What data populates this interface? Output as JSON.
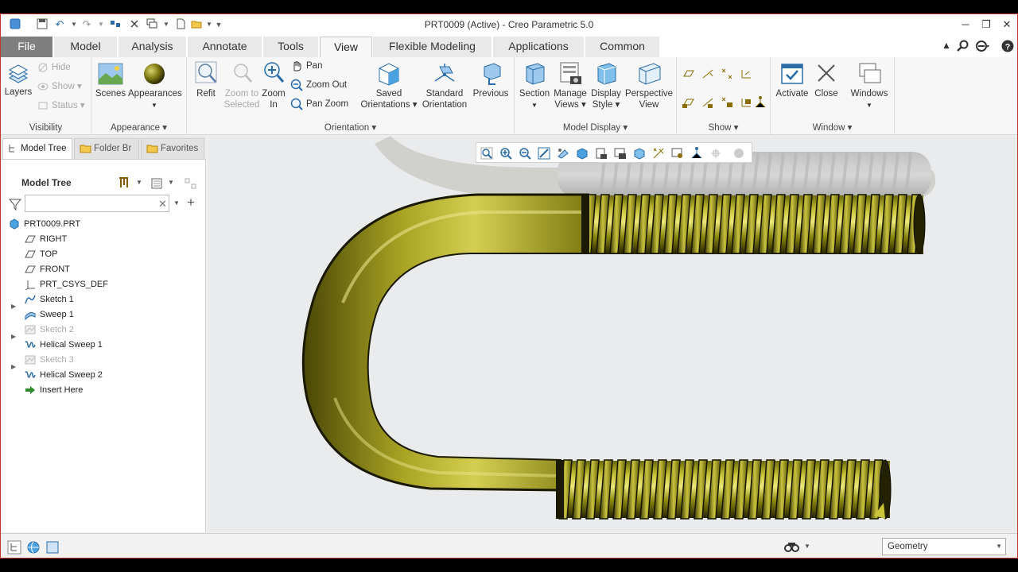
{
  "window": {
    "title": "PRT0009 (Active) - Creo Parametric 5.0"
  },
  "tabs": [
    "File",
    "Model",
    "Analysis",
    "Annotate",
    "Tools",
    "View",
    "Flexible Modeling",
    "Applications",
    "Common"
  ],
  "active_tab": "View",
  "ribbon": {
    "visibility": {
      "group_label": "Visibility",
      "layers": "Layers",
      "hide": "Hide",
      "show": "Show",
      "status": "Status"
    },
    "appearance": {
      "group_label": "Appearance",
      "scenes": "Scenes",
      "appearances": "Appearances"
    },
    "orientation": {
      "group_label": "Orientation",
      "refit": "Refit",
      "zoom_to_selected_1": "Zoom to",
      "zoom_to_selected_2": "Selected",
      "zoom_in_1": "Zoom",
      "zoom_in_2": "In",
      "pan": "Pan",
      "zoom_out": "Zoom Out",
      "pan_zoom": "Pan Zoom",
      "saved_1": "Saved",
      "saved_2": "Orientations",
      "standard_1": "Standard",
      "standard_2": "Orientation",
      "previous": "Previous"
    },
    "model_display": {
      "group_label": "Model Display",
      "section": "Section",
      "manage_1": "Manage",
      "manage_2": "Views",
      "display_1": "Display",
      "display_2": "Style",
      "perspective_1": "Perspective",
      "perspective_2": "View"
    },
    "show": {
      "group_label": "Show"
    },
    "window": {
      "group_label": "Window",
      "activate": "Activate",
      "close": "Close",
      "windows": "Windows"
    }
  },
  "navigator": {
    "tabs": [
      "Model Tree",
      "Folder Br",
      "Favorites"
    ],
    "header": "Model Tree",
    "filter_placeholder": "",
    "items": [
      {
        "label": "PRT0009.PRT",
        "icon": "part-icon",
        "enabled": true
      },
      {
        "label": "RIGHT",
        "icon": "datum-plane-icon",
        "enabled": true
      },
      {
        "label": "TOP",
        "icon": "datum-plane-icon",
        "enabled": true
      },
      {
        "label": "FRONT",
        "icon": "datum-plane-icon",
        "enabled": true
      },
      {
        "label": "PRT_CSYS_DEF",
        "icon": "csys-icon",
        "enabled": true
      },
      {
        "label": "Sketch 1",
        "icon": "sketch-icon",
        "enabled": true
      },
      {
        "label": "Sweep 1",
        "icon": "sweep-icon",
        "enabled": true
      },
      {
        "label": "Sketch 2",
        "icon": "sketch-icon",
        "enabled": false
      },
      {
        "label": "Helical Sweep 1",
        "icon": "helical-sweep-icon",
        "enabled": true
      },
      {
        "label": "Sketch 3",
        "icon": "sketch-icon",
        "enabled": false
      },
      {
        "label": "Helical Sweep 2",
        "icon": "helical-sweep-icon",
        "enabled": true
      },
      {
        "label": "Insert Here",
        "icon": "insert-arrow-icon",
        "enabled": true
      }
    ]
  },
  "statusbar": {
    "selection_filter": "Geometry"
  },
  "colors": {
    "model": "#9c9a14",
    "background": "#eaebec",
    "accent": "#2a6ca8"
  }
}
